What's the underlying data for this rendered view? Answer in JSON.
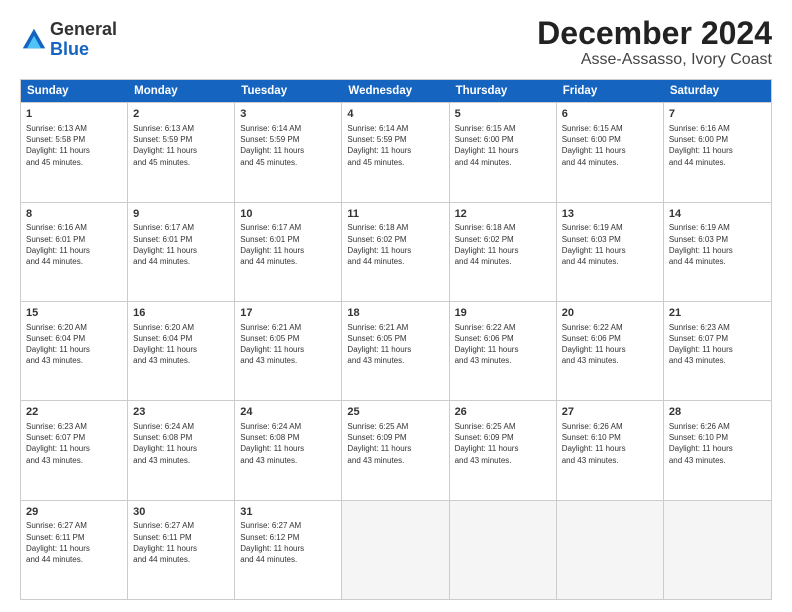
{
  "logo": {
    "general": "General",
    "blue": "Blue"
  },
  "title": "December 2024",
  "subtitle": "Asse-Assasso, Ivory Coast",
  "header_days": [
    "Sunday",
    "Monday",
    "Tuesday",
    "Wednesday",
    "Thursday",
    "Friday",
    "Saturday"
  ],
  "weeks": [
    [
      {
        "day": "1",
        "info": "Sunrise: 6:13 AM\nSunset: 5:58 PM\nDaylight: 11 hours\nand 45 minutes."
      },
      {
        "day": "2",
        "info": "Sunrise: 6:13 AM\nSunset: 5:59 PM\nDaylight: 11 hours\nand 45 minutes."
      },
      {
        "day": "3",
        "info": "Sunrise: 6:14 AM\nSunset: 5:59 PM\nDaylight: 11 hours\nand 45 minutes."
      },
      {
        "day": "4",
        "info": "Sunrise: 6:14 AM\nSunset: 5:59 PM\nDaylight: 11 hours\nand 45 minutes."
      },
      {
        "day": "5",
        "info": "Sunrise: 6:15 AM\nSunset: 6:00 PM\nDaylight: 11 hours\nand 44 minutes."
      },
      {
        "day": "6",
        "info": "Sunrise: 6:15 AM\nSunset: 6:00 PM\nDaylight: 11 hours\nand 44 minutes."
      },
      {
        "day": "7",
        "info": "Sunrise: 6:16 AM\nSunset: 6:00 PM\nDaylight: 11 hours\nand 44 minutes."
      }
    ],
    [
      {
        "day": "8",
        "info": "Sunrise: 6:16 AM\nSunset: 6:01 PM\nDaylight: 11 hours\nand 44 minutes."
      },
      {
        "day": "9",
        "info": "Sunrise: 6:17 AM\nSunset: 6:01 PM\nDaylight: 11 hours\nand 44 minutes."
      },
      {
        "day": "10",
        "info": "Sunrise: 6:17 AM\nSunset: 6:01 PM\nDaylight: 11 hours\nand 44 minutes."
      },
      {
        "day": "11",
        "info": "Sunrise: 6:18 AM\nSunset: 6:02 PM\nDaylight: 11 hours\nand 44 minutes."
      },
      {
        "day": "12",
        "info": "Sunrise: 6:18 AM\nSunset: 6:02 PM\nDaylight: 11 hours\nand 44 minutes."
      },
      {
        "day": "13",
        "info": "Sunrise: 6:19 AM\nSunset: 6:03 PM\nDaylight: 11 hours\nand 44 minutes."
      },
      {
        "day": "14",
        "info": "Sunrise: 6:19 AM\nSunset: 6:03 PM\nDaylight: 11 hours\nand 44 minutes."
      }
    ],
    [
      {
        "day": "15",
        "info": "Sunrise: 6:20 AM\nSunset: 6:04 PM\nDaylight: 11 hours\nand 43 minutes."
      },
      {
        "day": "16",
        "info": "Sunrise: 6:20 AM\nSunset: 6:04 PM\nDaylight: 11 hours\nand 43 minutes."
      },
      {
        "day": "17",
        "info": "Sunrise: 6:21 AM\nSunset: 6:05 PM\nDaylight: 11 hours\nand 43 minutes."
      },
      {
        "day": "18",
        "info": "Sunrise: 6:21 AM\nSunset: 6:05 PM\nDaylight: 11 hours\nand 43 minutes."
      },
      {
        "day": "19",
        "info": "Sunrise: 6:22 AM\nSunset: 6:06 PM\nDaylight: 11 hours\nand 43 minutes."
      },
      {
        "day": "20",
        "info": "Sunrise: 6:22 AM\nSunset: 6:06 PM\nDaylight: 11 hours\nand 43 minutes."
      },
      {
        "day": "21",
        "info": "Sunrise: 6:23 AM\nSunset: 6:07 PM\nDaylight: 11 hours\nand 43 minutes."
      }
    ],
    [
      {
        "day": "22",
        "info": "Sunrise: 6:23 AM\nSunset: 6:07 PM\nDaylight: 11 hours\nand 43 minutes."
      },
      {
        "day": "23",
        "info": "Sunrise: 6:24 AM\nSunset: 6:08 PM\nDaylight: 11 hours\nand 43 minutes."
      },
      {
        "day": "24",
        "info": "Sunrise: 6:24 AM\nSunset: 6:08 PM\nDaylight: 11 hours\nand 43 minutes."
      },
      {
        "day": "25",
        "info": "Sunrise: 6:25 AM\nSunset: 6:09 PM\nDaylight: 11 hours\nand 43 minutes."
      },
      {
        "day": "26",
        "info": "Sunrise: 6:25 AM\nSunset: 6:09 PM\nDaylight: 11 hours\nand 43 minutes."
      },
      {
        "day": "27",
        "info": "Sunrise: 6:26 AM\nSunset: 6:10 PM\nDaylight: 11 hours\nand 43 minutes."
      },
      {
        "day": "28",
        "info": "Sunrise: 6:26 AM\nSunset: 6:10 PM\nDaylight: 11 hours\nand 43 minutes."
      }
    ],
    [
      {
        "day": "29",
        "info": "Sunrise: 6:27 AM\nSunset: 6:11 PM\nDaylight: 11 hours\nand 44 minutes."
      },
      {
        "day": "30",
        "info": "Sunrise: 6:27 AM\nSunset: 6:11 PM\nDaylight: 11 hours\nand 44 minutes."
      },
      {
        "day": "31",
        "info": "Sunrise: 6:27 AM\nSunset: 6:12 PM\nDaylight: 11 hours\nand 44 minutes."
      },
      {
        "day": "",
        "info": ""
      },
      {
        "day": "",
        "info": ""
      },
      {
        "day": "",
        "info": ""
      },
      {
        "day": "",
        "info": ""
      }
    ]
  ]
}
